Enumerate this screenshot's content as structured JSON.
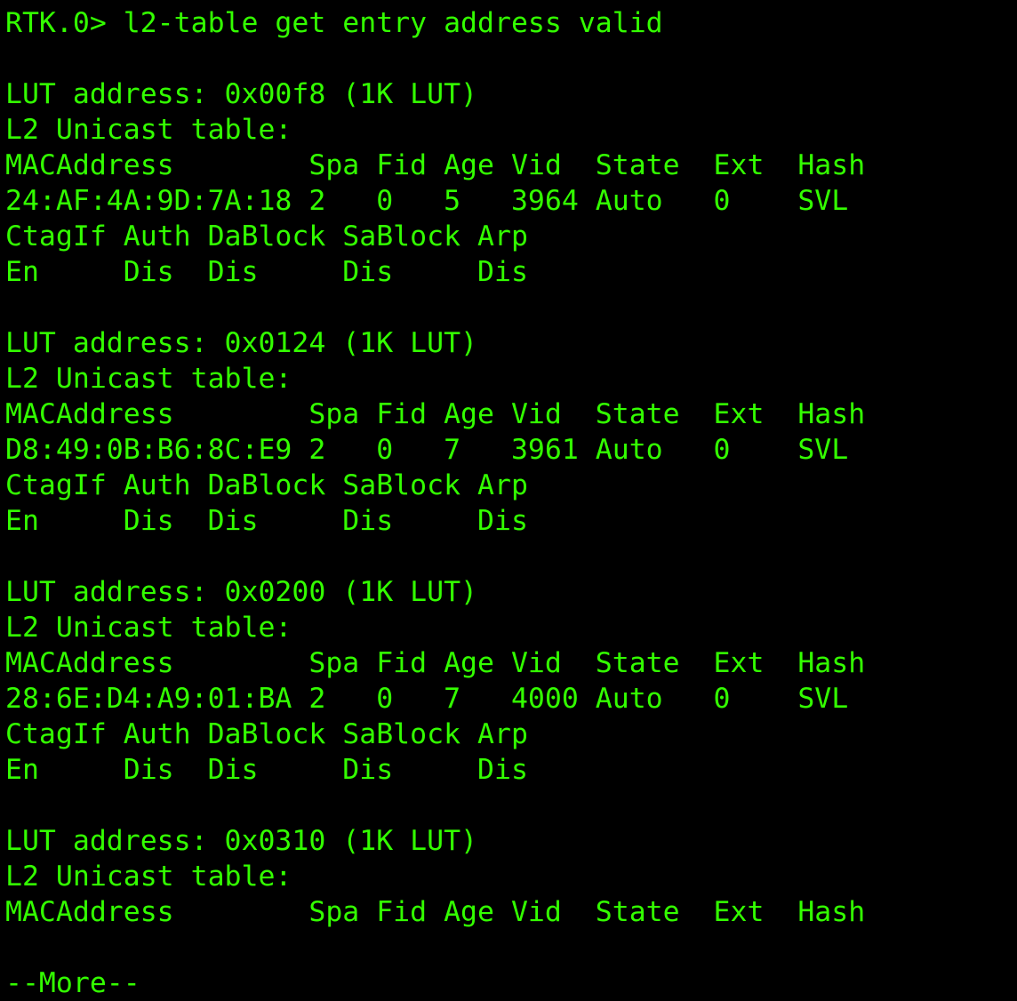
{
  "terminal": {
    "text_color": "#33ff00",
    "background_color": "#000000",
    "prompt": "RTK.0> l2-table get entry address valid",
    "blocks": [
      {
        "lut": "LUT address: 0x00f8 (1K LUT)",
        "table": "L2 Unicast table:",
        "header1": "MACAddress        Spa Fid Age Vid  State  Ext  Hash",
        "row1": "24:AF:4A:9D:7A:18 2   0   5   3964 Auto   0    SVL",
        "header2": "CtagIf Auth DaBlock SaBlock Arp",
        "row2": "En     Dis  Dis     Dis     Dis"
      },
      {
        "lut": "LUT address: 0x0124 (1K LUT)",
        "table": "L2 Unicast table:",
        "header1": "MACAddress        Spa Fid Age Vid  State  Ext  Hash",
        "row1": "D8:49:0B:B6:8C:E9 2   0   7   3961 Auto   0    SVL",
        "header2": "CtagIf Auth DaBlock SaBlock Arp",
        "row2": "En     Dis  Dis     Dis     Dis"
      },
      {
        "lut": "LUT address: 0x0200 (1K LUT)",
        "table": "L2 Unicast table:",
        "header1": "MACAddress        Spa Fid Age Vid  State  Ext  Hash",
        "row1": "28:6E:D4:A9:01:BA 2   0   7   4000 Auto   0    SVL",
        "header2": "CtagIf Auth DaBlock SaBlock Arp",
        "row2": "En     Dis  Dis     Dis     Dis"
      },
      {
        "lut": "LUT address: 0x0310 (1K LUT)",
        "table": "L2 Unicast table:",
        "header1": "MACAddress        Spa Fid Age Vid  State  Ext  Hash"
      }
    ],
    "pager": "--More--"
  }
}
